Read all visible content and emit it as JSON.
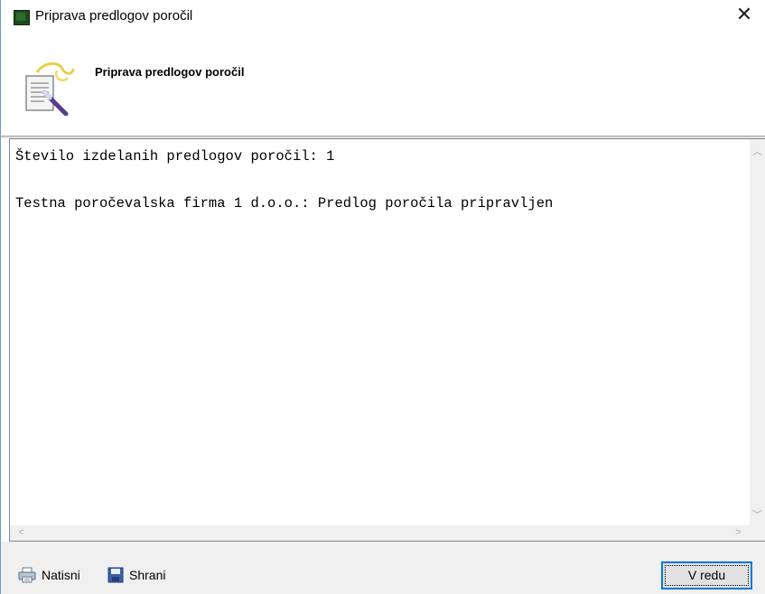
{
  "window": {
    "title": "Priprava predlogov poročil",
    "close_label": "✕"
  },
  "header": {
    "title": "Priprava predlogov poročil",
    "icon": "wizard-scroll-icon"
  },
  "output": {
    "lines": [
      "Število izdelanih predlogov poročil: 1",
      "",
      "Testna poročevalska firma 1 d.o.o.: Predlog poročila pripravljen"
    ]
  },
  "footer": {
    "print_label": "Natisni",
    "save_label": "Shrani",
    "ok_label": "V redu"
  },
  "colors": {
    "accent": "#0078d7",
    "window_border": "#6e9ec9"
  }
}
